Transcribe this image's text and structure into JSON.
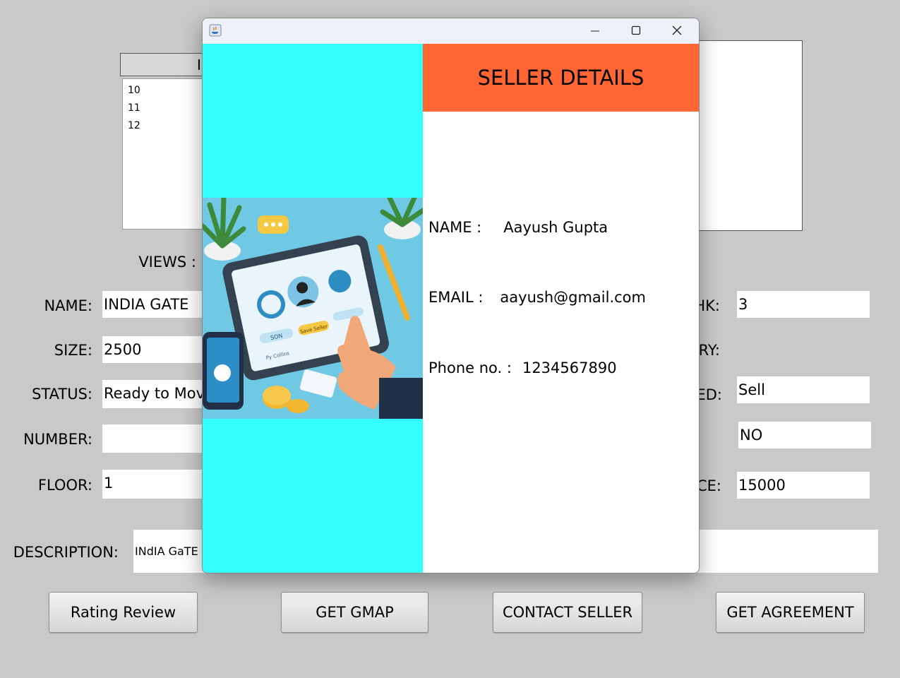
{
  "table": {
    "header_partial": "I",
    "rows": [
      "10",
      "11",
      "12"
    ]
  },
  "form": {
    "views_label": "VIEWS :",
    "name_label": "NAME:",
    "name_value": "INDIA GATE",
    "size_label": "SIZE:",
    "size_value": "2500",
    "status_label": "STATUS:",
    "status_value": "Ready to Move",
    "number_label": "NUMBER:",
    "number_value": "",
    "floor_label": "FLOOR:",
    "floor_value": "1",
    "description_label": "DESCRIPTION:",
    "description_value": "INdIA GaTE",
    "bhk_label_partial": "HK:",
    "bhk_value": "3",
    "category_label_partial": "RY:",
    "listed_label_partial": "ED:",
    "listed_value": "Sell",
    "right_field_value": "NO",
    "price_label_partial": "CE:",
    "price_value": "15000"
  },
  "buttons": {
    "rating_review": "Rating Review",
    "get_gmap": "GET GMAP",
    "contact_seller": "CONTACT SELLER",
    "get_agreement": "GET AGREEMENT"
  },
  "dialog": {
    "title": "SELLER DETAILS",
    "name_label": "NAME :",
    "name_value": "Aayush Gupta",
    "email_label": "EMAIL :",
    "email_value": "aayush@gmail.com",
    "phone_label": "Phone no. :",
    "phone_value": "1234567890",
    "illustration": {
      "button_left": "SON",
      "button_right": "Save Seller",
      "sub_label": "Py Collins"
    }
  },
  "colors": {
    "background": "#c9c9c9",
    "dialog_left_panel": "#33ffff",
    "dialog_header": "#ff6633"
  },
  "icons": [
    "java-app-icon",
    "minimize-icon",
    "maximize-icon",
    "close-icon"
  ]
}
